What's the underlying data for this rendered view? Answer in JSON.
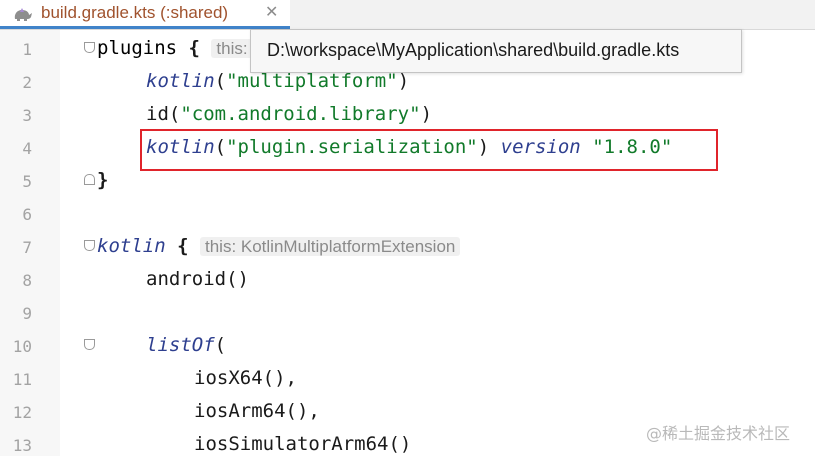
{
  "tab": {
    "title": "build.gradle.kts (:shared)",
    "close_glyph": "✕",
    "icon": "gradle-elephant-icon"
  },
  "tooltip": {
    "text": "D:\\workspace\\MyApplication\\shared\\build.gradle.kts"
  },
  "gutter": {
    "line_numbers": [
      "1",
      "2",
      "3",
      "4",
      "5",
      "6",
      "7",
      "8",
      "9",
      "10",
      "11",
      "12",
      "13"
    ]
  },
  "code": {
    "l1": {
      "text": "plugins ",
      "brace": "{",
      "hint": "this:"
    },
    "l2": {
      "fn": "kotlin",
      "open": "(",
      "str": "\"multiplatform\"",
      "close": ")"
    },
    "l3": {
      "fn": "id",
      "open": "(",
      "str": "\"com.android.library\"",
      "close": ")"
    },
    "l4": {
      "fn": "kotlin",
      "open": "(",
      "str": "\"plugin.serialization\"",
      "close": ") ",
      "version_kw": "version",
      "version_val": "\"1.8.0\""
    },
    "l5": {
      "brace": "}"
    },
    "l7": {
      "fn": "kotlin",
      "brace": " {",
      "hint": "this: KotlinMultiplatformExtension"
    },
    "l8": {
      "text": "android()"
    },
    "l10": {
      "fn": "listOf",
      "open": "("
    },
    "l11": {
      "text": "iosX64(),"
    },
    "l12": {
      "text": "iosArm64(),"
    },
    "l13": {
      "text": "iosSimulatorArm64()"
    }
  },
  "watermark": "@稀土掘金技术社区",
  "colors": {
    "tab_title": "#a0522d",
    "string": "#117a2a",
    "function_italic": "#2e3f8f",
    "highlight_border": "#e0242b",
    "tab_underline": "#4083c9"
  }
}
